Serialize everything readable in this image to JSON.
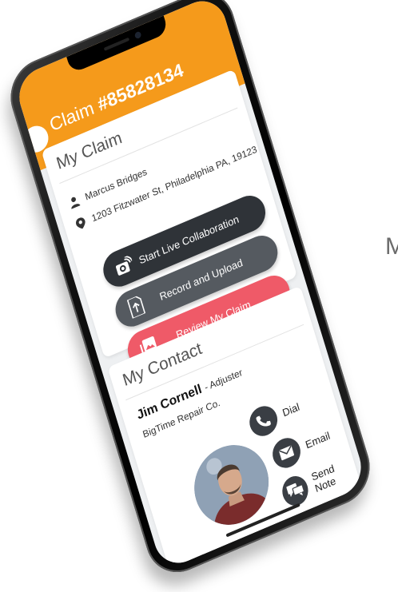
{
  "header": {
    "claim_prefix": "Claim",
    "claim_number": "#85828134"
  },
  "my_claim": {
    "title": "My Claim",
    "customer_name": "Marcus Bridges",
    "address": "1203 Fitzwater St, Philadelphia PA, 19123",
    "buttons": [
      {
        "label": "Start Live Collaboration",
        "icon": "camera-live-icon"
      },
      {
        "label": "Record and Upload",
        "icon": "upload-icon"
      },
      {
        "label": "Review My Claim",
        "icon": "gallery-icon"
      }
    ]
  },
  "my_contact": {
    "title": "My Contact",
    "name": "Jim Cornell",
    "role": "- Adjuster",
    "company": "BigTime Repair Co.",
    "actions": [
      {
        "label": "Dial",
        "icon": "phone-icon"
      },
      {
        "label": "Email",
        "icon": "mail-icon"
      },
      {
        "label": "Send Note",
        "icon": "chat-icon"
      }
    ]
  },
  "edge_text": "M",
  "colors": {
    "header": "#f59a1b",
    "dark_button": "#2f3338",
    "gray_button": "#555a60",
    "red_button": "#ef5a68"
  }
}
